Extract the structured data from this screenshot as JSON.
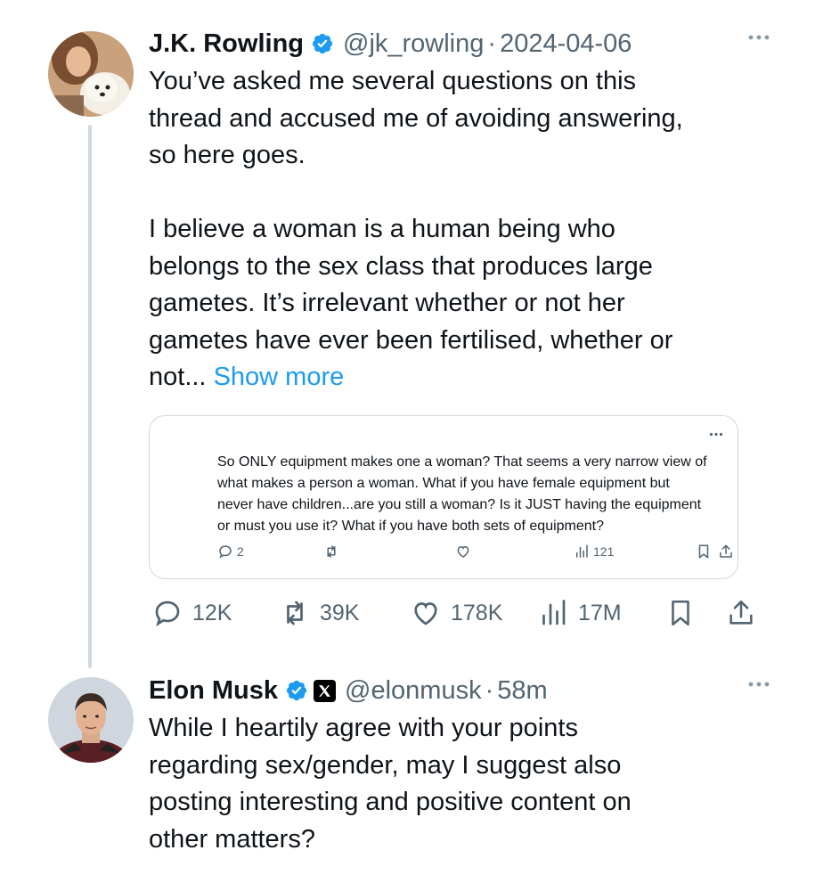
{
  "tweets": [
    {
      "author_name": "J.K. Rowling",
      "handle": "@jk_rowling",
      "separator": "·",
      "time": "2024-04-06",
      "lines_p1": [
        "You’ve asked me several questions on this",
        "thread and accused me of avoiding answering,",
        "so here goes."
      ],
      "lines_p2": [
        "I believe a woman is a human being who",
        "belongs to the sex class that produces large",
        "gametes. It’s irrelevant whether or not her",
        "gametes have ever been fertilised, whether or"
      ],
      "last_line": "not...",
      "show_more": "Show more",
      "quoted": {
        "lines": [
          "So ONLY equipment makes one a woman? That seems a very narrow view of",
          "what makes a person a woman. What if you have female equipment but",
          "never have children...are you still a woman? Is it JUST having the equipment",
          "or must you use it? What if you have both sets of equipment?"
        ],
        "replies": "2",
        "views": "121"
      },
      "stats": {
        "replies": "12K",
        "reposts": "39K",
        "likes": "178K",
        "views": "17M"
      }
    },
    {
      "author_name": "Elon Musk",
      "handle": "@elonmusk",
      "separator": "·",
      "time": "58m",
      "lines": [
        "While I heartily agree with your points",
        "regarding sex/gender, may I suggest also",
        "posting interesting and positive content on",
        "other matters?"
      ]
    }
  ],
  "colors": {
    "verified_blue": "#1d9bf0",
    "link_blue": "#1d9bf0",
    "secondary_text": "#536471",
    "border": "#cfd9de",
    "thread_line": "#cfd9de"
  },
  "icons": [
    "verified-badge-icon",
    "x-logo-icon",
    "more-icon",
    "reply-icon",
    "repost-icon",
    "like-icon",
    "views-icon",
    "bookmark-icon",
    "share-icon"
  ]
}
